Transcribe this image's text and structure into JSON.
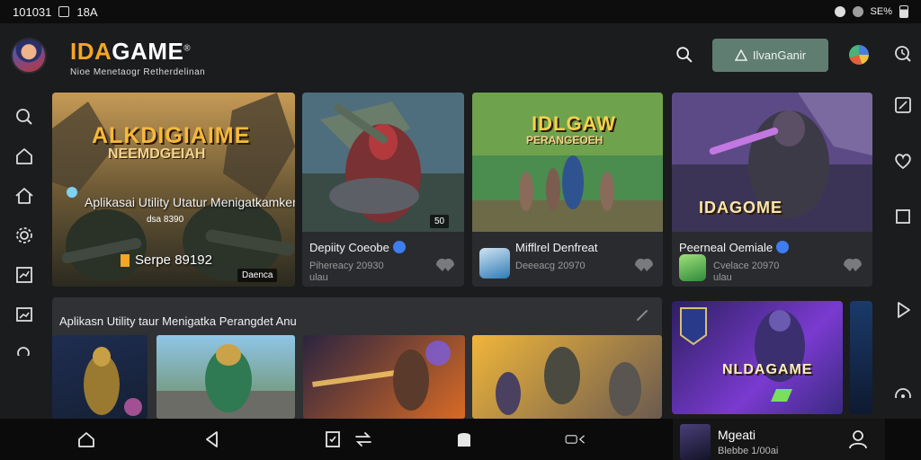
{
  "status_bar": {
    "time": "101031",
    "indicator": "18A",
    "right_text": "SE%"
  },
  "header": {
    "brand_first": "IDA",
    "brand_rest": "GAME",
    "brand_mark": "®",
    "brand_subtitle": "Nioe Menetaogr Retherdelinan",
    "cta_label": "IlvanGanir"
  },
  "feature": {
    "title": "ALKDIGIAIME",
    "subtitle": "NEEMDGEIAH",
    "headline": "Aplikasai Utility Utatur Menigatkamken Perangdet Anu",
    "sub_badge": "dsa 8390",
    "price": "Serpe 89192",
    "tag": "Daenca"
  },
  "cards": [
    {
      "title": "Depiity Coeobe",
      "meta1": "Pihereacy 20930",
      "meta2": "ulau",
      "count_badge": "50",
      "art_text": ""
    },
    {
      "title": "Mifflrel Denfreat",
      "meta1": "Deeeacg 20970",
      "meta2": "",
      "art_text": "IDLGAW",
      "art_subtext": "PERANGEOEH"
    },
    {
      "title": "Peerneal Oemiale",
      "meta1": "Cvelace 20970",
      "meta2": "ulau",
      "art_text": "IDAGOME"
    }
  ],
  "strip": {
    "title": "Aplikasn Utility taur Menigatka Perangdet Anu"
  },
  "promo": {
    "art_text": "NLDAGAME"
  },
  "mini_player": {
    "title": "Mgeati",
    "subtitle": "Blebbe 1/00ai"
  },
  "colors": {
    "accent": "#5f7d71",
    "brand": "#f5a623",
    "verified": "#3d7df0"
  }
}
